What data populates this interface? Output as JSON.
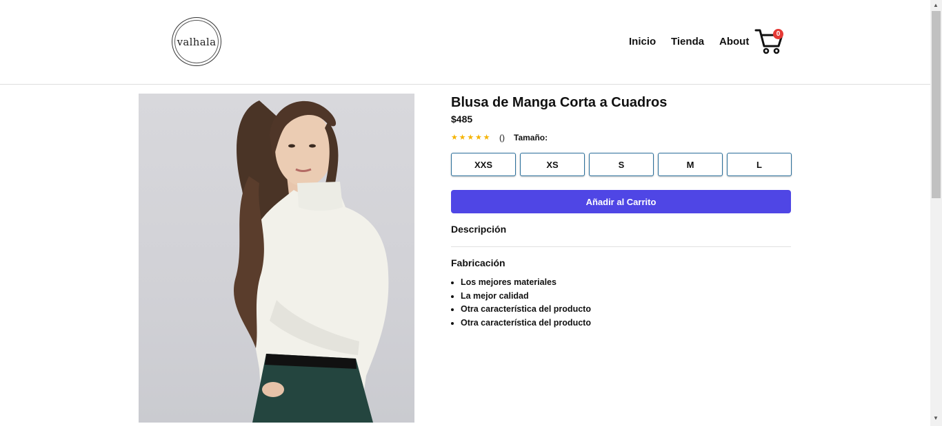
{
  "header": {
    "logo_text": "valhala",
    "nav": {
      "inicio": "Inicio",
      "tienda": "Tienda",
      "about": "About"
    },
    "cart_count": "0",
    "cart_icon": "shopping-cart-icon"
  },
  "product": {
    "title": "Blusa de Manga Corta a Cuadros",
    "price": "$485",
    "stars": "★★★★★",
    "rating": 5,
    "reviews": "()",
    "size_label": "Tamaño:",
    "sizes": [
      "XXS",
      "XS",
      "S",
      "M",
      "L"
    ],
    "add_to_cart": "Añadir al Carrito",
    "description_heading": "Descripción",
    "fabrication_heading": "Fabricación",
    "features": [
      "Los mejores materiales",
      "La mejor calidad",
      "Otra característica del producto",
      "Otra característica del producto"
    ]
  },
  "colors": {
    "accent": "#4f46e5",
    "badge": "#e53935",
    "star": "#f5b301",
    "size_border": "#2a6f9b"
  }
}
